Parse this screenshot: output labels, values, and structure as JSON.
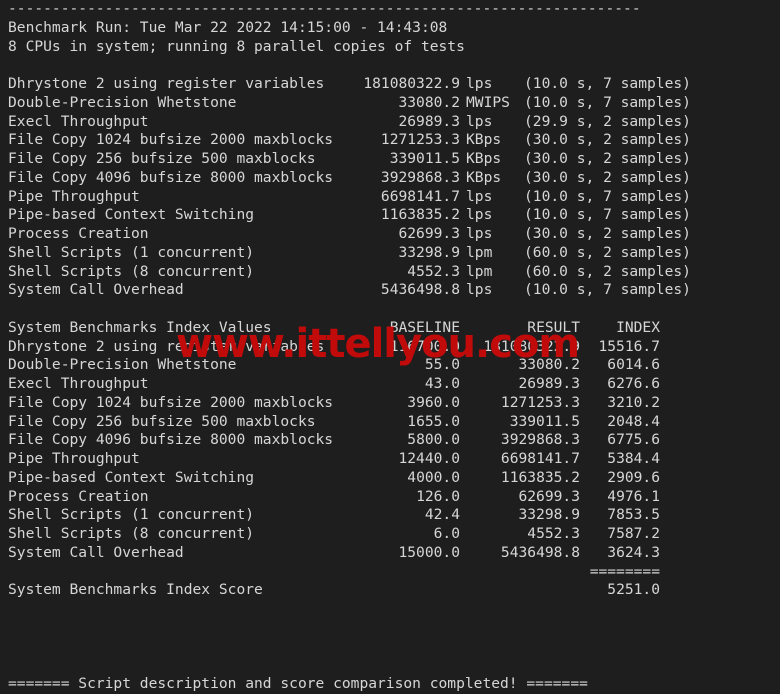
{
  "terminal": {
    "top_rule": "------------------------------------------------------------------------",
    "header_lines": [
      "Benchmark Run: Tue Mar 22 2022 14:15:00 - 14:43:08",
      "8 CPUs in system; running 8 parallel copies of tests"
    ],
    "run_results": [
      {
        "name": "Dhrystone 2 using register variables",
        "value": "181080322.9",
        "unit": "lps",
        "samples": "(10.0 s, 7 samples)"
      },
      {
        "name": "Double-Precision Whetstone",
        "value": "33080.2",
        "unit": "MWIPS",
        "samples": "(10.0 s, 7 samples)"
      },
      {
        "name": "Execl Throughput",
        "value": "26989.3",
        "unit": "lps",
        "samples": "(29.9 s, 2 samples)"
      },
      {
        "name": "File Copy 1024 bufsize 2000 maxblocks",
        "value": "1271253.3",
        "unit": "KBps",
        "samples": "(30.0 s, 2 samples)"
      },
      {
        "name": "File Copy 256 bufsize 500 maxblocks",
        "value": "339011.5",
        "unit": "KBps",
        "samples": "(30.0 s, 2 samples)"
      },
      {
        "name": "File Copy 4096 bufsize 8000 maxblocks",
        "value": "3929868.3",
        "unit": "KBps",
        "samples": "(30.0 s, 2 samples)"
      },
      {
        "name": "Pipe Throughput",
        "value": "6698141.7",
        "unit": "lps",
        "samples": "(10.0 s, 7 samples)"
      },
      {
        "name": "Pipe-based Context Switching",
        "value": "1163835.2",
        "unit": "lps",
        "samples": "(10.0 s, 7 samples)"
      },
      {
        "name": "Process Creation",
        "value": "62699.3",
        "unit": "lps",
        "samples": "(30.0 s, 2 samples)"
      },
      {
        "name": "Shell Scripts (1 concurrent)",
        "value": "33298.9",
        "unit": "lpm",
        "samples": "(60.0 s, 2 samples)"
      },
      {
        "name": "Shell Scripts (8 concurrent)",
        "value": "4552.3",
        "unit": "lpm",
        "samples": "(60.0 s, 2 samples)"
      },
      {
        "name": "System Call Overhead",
        "value": "5436498.8",
        "unit": "lps",
        "samples": "(10.0 s, 7 samples)"
      }
    ],
    "index_header": {
      "title": "System Benchmarks Index Values",
      "baseline": "BASELINE",
      "result": "RESULT",
      "index": "INDEX"
    },
    "index_rows": [
      {
        "name": "Dhrystone 2 using register variables",
        "baseline": "116700.0",
        "result": "181080322.9",
        "index": "15516.7"
      },
      {
        "name": "Double-Precision Whetstone",
        "baseline": "55.0",
        "result": "33080.2",
        "index": "6014.6"
      },
      {
        "name": "Execl Throughput",
        "baseline": "43.0",
        "result": "26989.3",
        "index": "6276.6"
      },
      {
        "name": "File Copy 1024 bufsize 2000 maxblocks",
        "baseline": "3960.0",
        "result": "1271253.3",
        "index": "3210.2"
      },
      {
        "name": "File Copy 256 bufsize 500 maxblocks",
        "baseline": "1655.0",
        "result": "339011.5",
        "index": "2048.4"
      },
      {
        "name": "File Copy 4096 bufsize 8000 maxblocks",
        "baseline": "5800.0",
        "result": "3929868.3",
        "index": "6775.6"
      },
      {
        "name": "Pipe Throughput",
        "baseline": "12440.0",
        "result": "6698141.7",
        "index": "5384.4"
      },
      {
        "name": "Pipe-based Context Switching",
        "baseline": "4000.0",
        "result": "1163835.2",
        "index": "2909.6"
      },
      {
        "name": "Process Creation",
        "baseline": "126.0",
        "result": "62699.3",
        "index": "4976.1"
      },
      {
        "name": "Shell Scripts (1 concurrent)",
        "baseline": "42.4",
        "result": "33298.9",
        "index": "7853.5"
      },
      {
        "name": "Shell Scripts (8 concurrent)",
        "baseline": "6.0",
        "result": "4552.3",
        "index": "7587.2"
      },
      {
        "name": "System Call Overhead",
        "baseline": "15000.0",
        "result": "5436498.8",
        "index": "3624.3"
      }
    ],
    "separator": "========",
    "score": {
      "label": "System Benchmarks Index Score",
      "value": "5251.0"
    },
    "footer": "======= Script description and score comparison completed! ======="
  },
  "watermark": {
    "text": "www.ittellyou.com",
    "color": "#c10b0b"
  },
  "colors": {
    "background": "#1e1e1e",
    "foreground": "#d6d6d6"
  }
}
